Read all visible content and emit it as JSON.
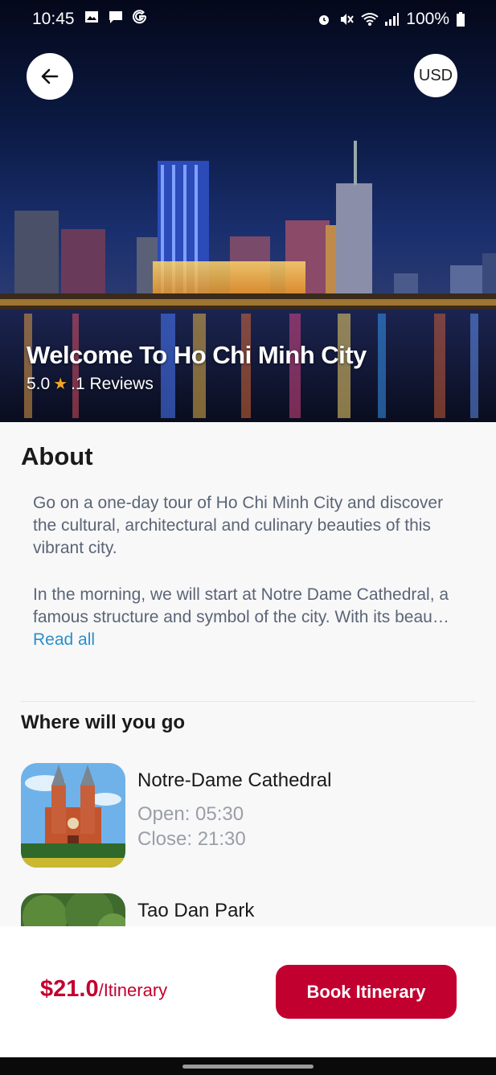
{
  "status_bar": {
    "time": "10:45",
    "battery": "100%",
    "icons": [
      "image-icon",
      "message-icon",
      "google-icon",
      "alarm-icon",
      "mute-icon",
      "wifi-icon",
      "signal-icon",
      "battery-icon"
    ]
  },
  "header": {
    "back_icon": "arrow-left-icon",
    "currency": "USD"
  },
  "hero": {
    "title": "Welcome To Ho Chi Minh City",
    "rating": "5.0",
    "reviews": ".1 Reviews"
  },
  "about": {
    "title": "About",
    "paragraph_1": "Go on a one-day tour of Ho Chi Minh City and discover the cultural, architectural and culinary beauties of this vibrant city.",
    "paragraph_2": "In the morning, we will start at Notre Dame Cathedral, a famous structure and symbol of the city. With its beau…",
    "read_all": "Read all"
  },
  "where_section": {
    "title": "Where will you go",
    "places": [
      {
        "name": "Notre-Dame Cathedral",
        "open": "Open: 05:30",
        "close": "Close: 21:30"
      },
      {
        "name": "Tao Dan Park"
      }
    ]
  },
  "booking": {
    "price": "$21.0",
    "unit": "/Itinerary",
    "button": "Book Itinerary"
  },
  "colors": {
    "accent": "#c2002f",
    "link": "#2b8fc9",
    "star": "#f5a623"
  }
}
